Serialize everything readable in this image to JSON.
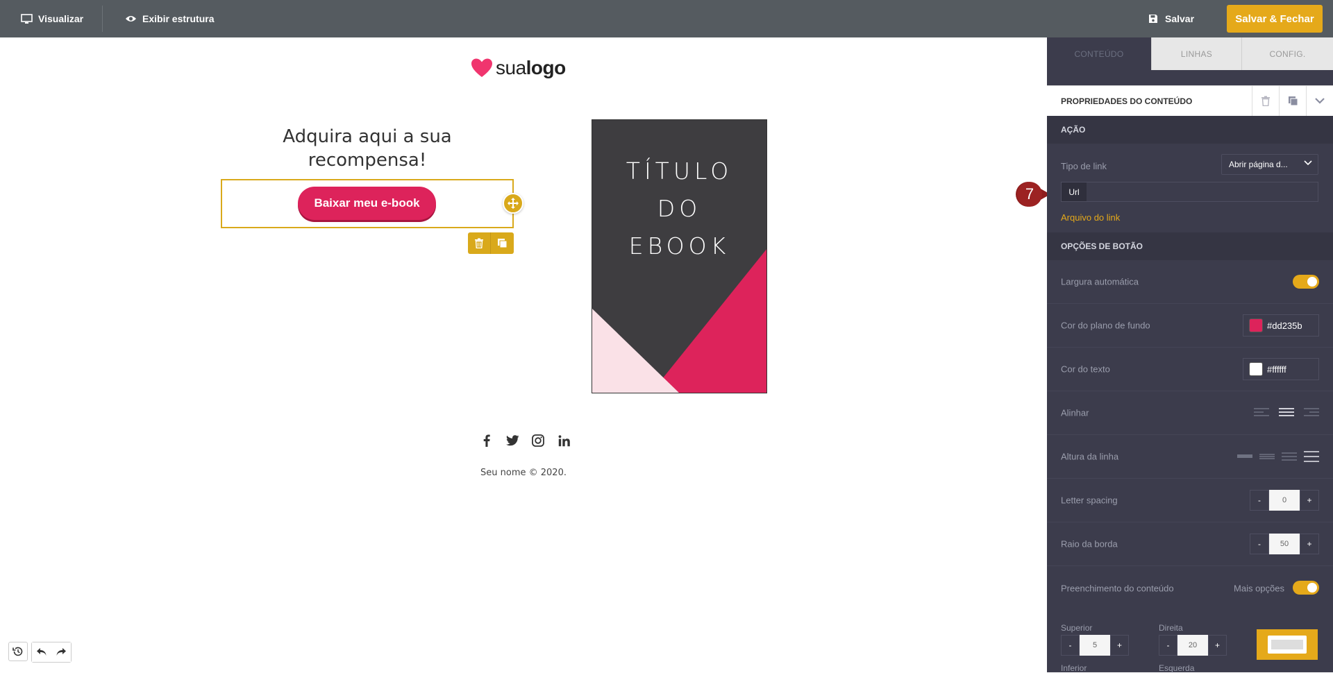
{
  "topbar": {
    "visualize_label": "Visualizar",
    "structure_label": "Exibir estrutura",
    "save_label": "Salvar",
    "save_close_label": "Salvar & Fechar"
  },
  "canvas": {
    "logo_prefix": "sua",
    "logo_bold": "logo",
    "headline": "Adquira aqui a sua recompensa!",
    "cta_label": "Baixar meu e-book",
    "ebook_title_line1": "TÍTULO",
    "ebook_title_line2": "DO",
    "ebook_title_line3": "EBOOK",
    "social_icons": [
      "facebook-icon",
      "twitter-icon",
      "instagram-icon",
      "linkedin-icon"
    ],
    "footer_text": "Seu nome © 2020."
  },
  "panel": {
    "tabs": [
      "CONTEÚDO",
      "LINHAS",
      "CONFIG."
    ],
    "properties_title": "PROPRIEDADES DO CONTEÚDO",
    "section_action": "AÇÃO",
    "link_type_label": "Tipo de link",
    "link_type_value": "Abrir página d...",
    "url_tag": "Url",
    "url_value": "",
    "file_link_label": "Arquivo do link",
    "section_button": "OPÇÕES DE BOTÃO",
    "auto_width_label": "Largura automática",
    "auto_width_on": true,
    "bg_color_label": "Cor do plano de fundo",
    "bg_color_value": "#dd235b",
    "text_color_label": "Cor do texto",
    "text_color_value": "#ffffff",
    "align_label": "Alinhar",
    "line_height_label": "Altura da linha",
    "letter_spacing_label": "Letter spacing",
    "letter_spacing_value": "0",
    "border_radius_label": "Raio da borda",
    "border_radius_value": "50",
    "padding_label": "Preenchimento do conteúdo",
    "more_options_label": "Mais opções",
    "more_options_on": true,
    "pad_top_label": "Superior",
    "pad_top_value": "5",
    "pad_right_label": "Direita",
    "pad_right_value": "20",
    "pad_bottom_label": "Inferior",
    "pad_left_label": "Esquerda",
    "minus": "-",
    "plus": "+"
  },
  "annotation": {
    "step_number": "7"
  },
  "colors": {
    "accent": "#e5a91a",
    "brand_pink": "#dd235b",
    "panel_bg": "#3c3c4c",
    "topbar_bg": "#555b60"
  }
}
